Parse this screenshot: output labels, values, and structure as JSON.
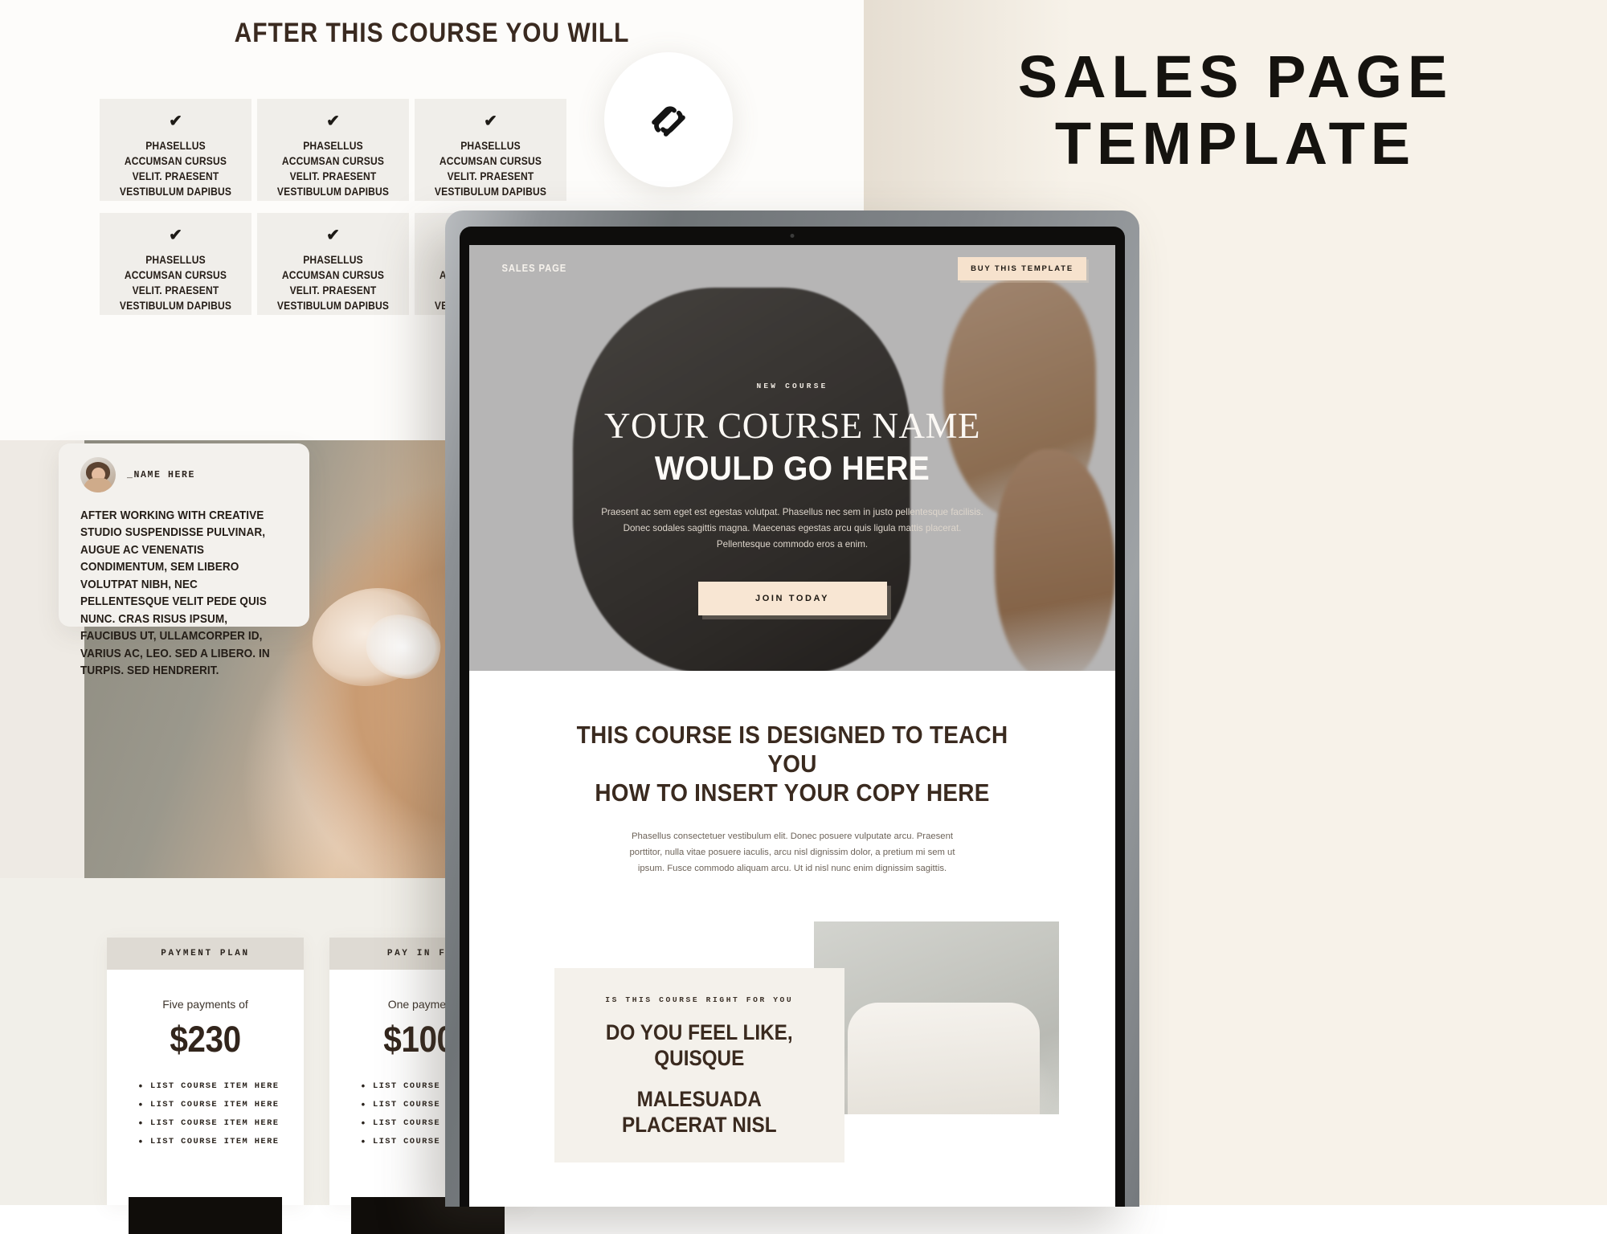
{
  "left_panel": {
    "heading": "AFTER THIS COURSE YOU WILL",
    "check_icon": "check-icon",
    "cards": [
      {
        "text": "PHASELLUS ACCUMSAN CURSUS VELIT. PRAESENT VESTIBULUM DAPIBUS NIBH."
      },
      {
        "text": "PHASELLUS ACCUMSAN CURSUS VELIT. PRAESENT VESTIBULUM DAPIBUS NIBH."
      },
      {
        "text": "PHASELLUS ACCUMSAN CURSUS VELIT. PRAESENT VESTIBULUM DAPIBUS NIBH."
      },
      {
        "text": "PHASELLUS ACCUMSAN CURSUS VELIT. PRAESENT VESTIBULUM DAPIBUS NIBH."
      },
      {
        "text": "PHASELLUS ACCUMSAN CURSUS VELIT. PRAESENT VESTIBULUM DAPIBUS NIBH."
      },
      {
        "text": "PHASELLUS ACCUMSAN CURSUS VELIT. PRAESENT VESTIBULUM DAPIBUS NIBH."
      }
    ]
  },
  "badge": {
    "icon": "squarespace-logo-icon"
  },
  "promo_title": {
    "line1": "SALES PAGE",
    "line2": "TEMPLATE"
  },
  "testimonial": {
    "avatar": "avatar-photo",
    "name": "_NAME HERE",
    "quote": "AFTER WORKING WITH CREATIVE STUDIO SUSPENDISSE PULVINAR, AUGUE AC VENENATIS CONDIMENTUM, SEM LIBERO VOLUTPAT NIBH, NEC PELLENTESQUE VELIT PEDE QUIS NUNC. CRAS RISUS IPSUM, FAUCIBUS UT, ULLAMCORPER ID, VARIUS AC, LEO. SED A LIBERO. IN TURPIS. SED HENDRERIT."
  },
  "pricing": [
    {
      "header": "PAYMENT PLAN",
      "subtitle": "Five payments of",
      "price": "$230",
      "items": [
        "LIST COURSE ITEM HERE",
        "LIST COURSE ITEM HERE",
        "LIST COURSE ITEM HERE",
        "LIST COURSE ITEM HERE"
      ]
    },
    {
      "header": "PAY IN FULL",
      "subtitle": "One payment of",
      "price": "$1000",
      "items": [
        "LIST COURSE ITEM HERE",
        "LIST COURSE ITEM HERE",
        "LIST COURSE ITEM HERE",
        "LIST COURSE ITEM HERE"
      ]
    }
  ],
  "laptop_site": {
    "nav": {
      "logo": "SALES PAGE",
      "cta": "BUY THIS TEMPLATE"
    },
    "hero": {
      "eyebrow": "NEW COURSE",
      "title_serif": "YOUR COURSE NAME",
      "title_condensed": "WOULD GO HERE",
      "paragraph": "Praesent ac sem eget est egestas volutpat. Phasellus nec sem in justo pellentesque facilisis. Donec sodales sagittis magna. Maecenas egestas arcu quis ligula mattis placerat. Pellentesque commodo eros a enim.",
      "cta": "JOIN TODAY"
    },
    "section": {
      "heading_line1": "THIS COURSE IS DESIGNED TO TEACH YOU",
      "heading_line2": "HOW TO INSERT YOUR COPY HERE",
      "paragraph": "Phasellus consectetuer vestibulum elit. Donec posuere vulputate arcu. Praesent porttitor, nulla vitae posuere iaculis, arcu nisl dignissim dolor, a pretium mi sem ut ipsum. Fusce commodo aliquam arcu. Ut id nisl nunc enim dignissim sagittis."
    },
    "lower": {
      "eyebrow": "IS THIS COURSE RIGHT FOR YOU",
      "heading_line1": "DO YOU FEEL LIKE, QUISQUE",
      "heading_line2": "MALESUADA PLACERAT NISL"
    }
  },
  "colors": {
    "cream_accent": "#f7e5d2",
    "dark_brown": "#3a2a1f",
    "panel_grey": "#f0eeea",
    "right_bg": "#f7f2e9"
  }
}
